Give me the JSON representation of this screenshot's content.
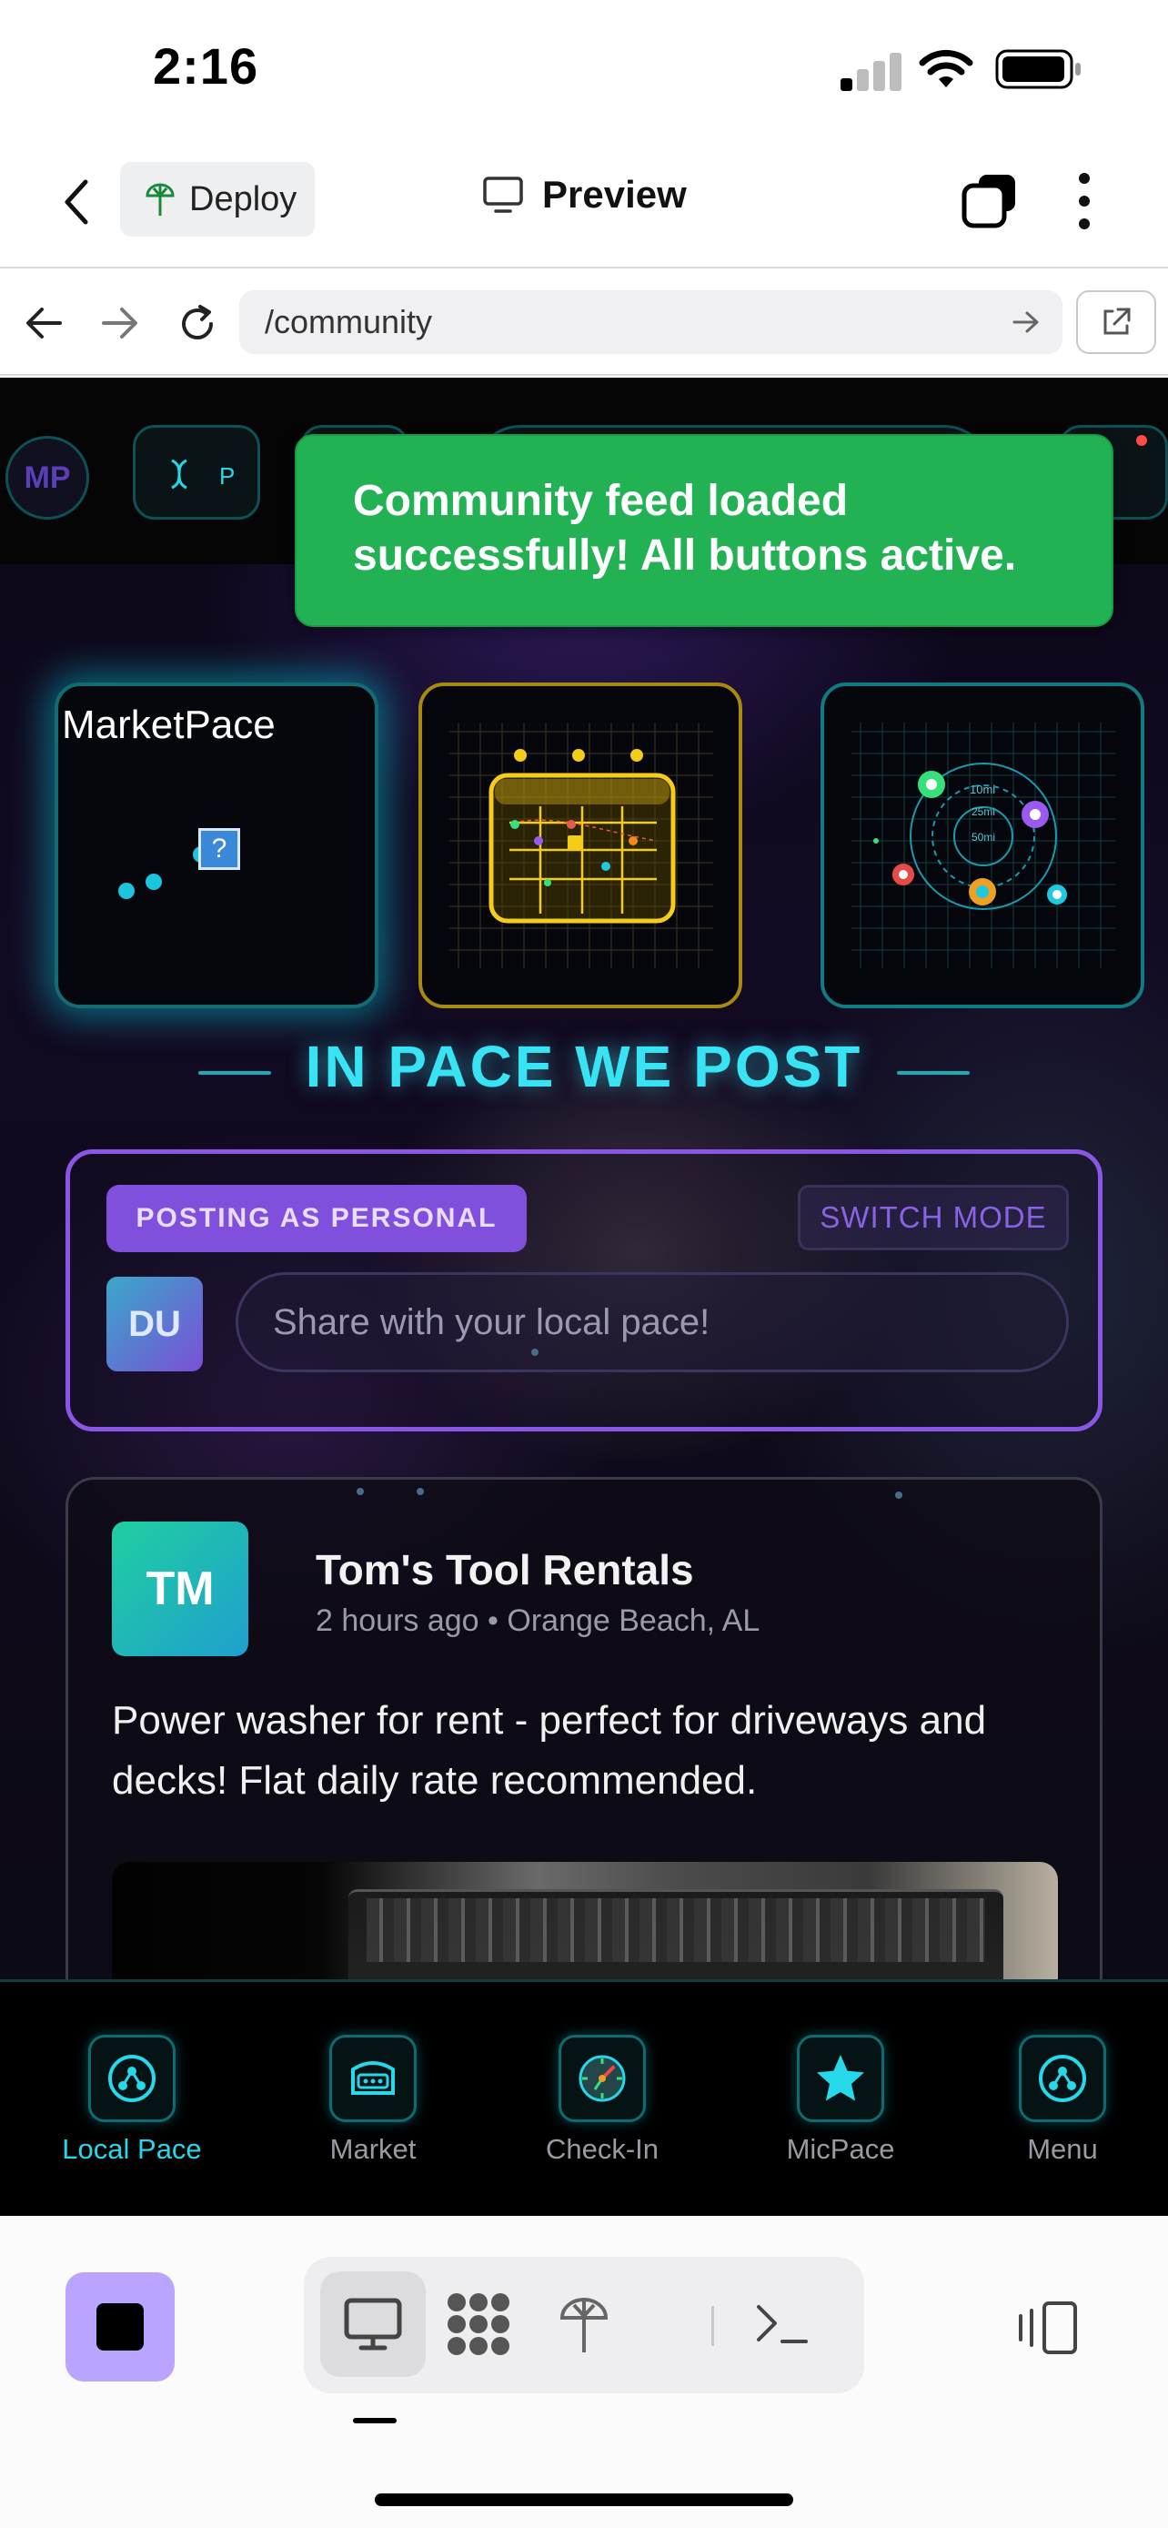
{
  "status_bar": {
    "time": "2:16"
  },
  "app_header": {
    "deploy_label": "Deploy",
    "preview_label": "Preview"
  },
  "browser": {
    "url": "/community"
  },
  "web": {
    "toast": "Community feed loaded successfully! All buttons active.",
    "nav_logo": "MP",
    "nav_pill_letter": "P",
    "tiles": {
      "marketpace_label": "MarketPace",
      "radar_labels": [
        "10mi",
        "25mi",
        "50mi"
      ]
    },
    "section_title": "IN PACE WE POST",
    "composer": {
      "mode_badge": "POSTING AS PERSONAL",
      "switch_label": "SWITCH MODE",
      "avatar_initials": "DU",
      "placeholder": "Share with your local pace!"
    },
    "post": {
      "avatar_initials": "TM",
      "author": "Tom's Tool Rentals",
      "time": "2 hours ago",
      "location": "Orange Beach, AL",
      "body": "Power washer for rent - perfect for driveways and decks! Flat daily rate recommended."
    },
    "tabs": [
      {
        "label": "Local Pace",
        "icon": "network-icon",
        "active": true
      },
      {
        "label": "Market",
        "icon": "storefront-icon",
        "active": false
      },
      {
        "label": "Check-In",
        "icon": "compass-icon",
        "active": false
      },
      {
        "label": "MicPace",
        "icon": "star-icon",
        "active": false
      },
      {
        "label": "Menu",
        "icon": "network-icon",
        "active": false
      }
    ]
  },
  "colors": {
    "accent_cyan": "#38e3f4",
    "toast_green": "#22b254",
    "purple": "#8050dd",
    "stop_button": "#b9a4ff"
  }
}
